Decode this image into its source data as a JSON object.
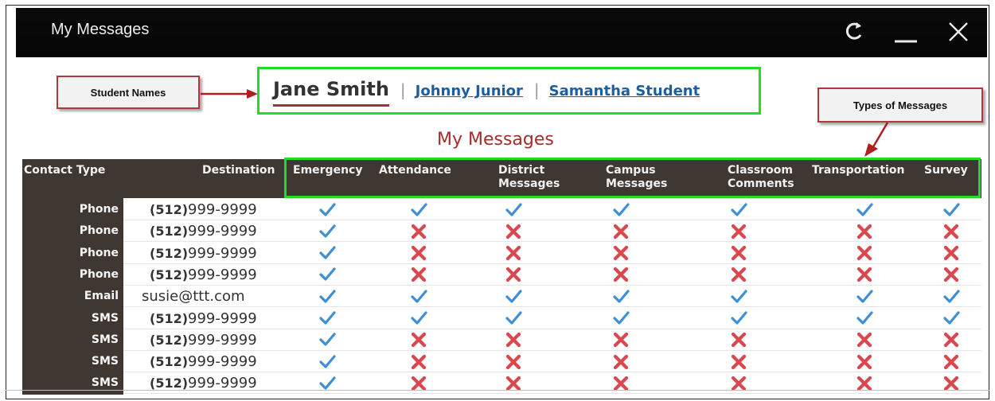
{
  "window": {
    "title": "My Messages",
    "refresh_icon": "refresh-icon",
    "minimize_icon": "minimize-icon",
    "close_icon": "close-icon"
  },
  "callouts": {
    "students": "Student Names",
    "types": "Types of Messages"
  },
  "students": {
    "active": "Jane Smith",
    "others": [
      "Johnny Junior",
      "Samantha Student"
    ],
    "separator": "|"
  },
  "heading": "My Messages",
  "table": {
    "headers": {
      "contact_type": "Contact Type",
      "destination": "Destination",
      "types": [
        [
          "Emergency"
        ],
        [
          "Attendance"
        ],
        [
          "District",
          "Messages"
        ],
        [
          "Campus",
          "Messages"
        ],
        [
          "Classroom",
          "Comments"
        ],
        [
          "Transportation"
        ],
        [
          "Survey"
        ]
      ]
    },
    "rows": [
      {
        "type": "Phone",
        "area": "(512)",
        "number": "999-9999",
        "flags": [
          true,
          true,
          true,
          true,
          true,
          true,
          true
        ]
      },
      {
        "type": "Phone",
        "area": "(512)",
        "number": "999-9999",
        "flags": [
          true,
          false,
          false,
          false,
          false,
          false,
          false
        ]
      },
      {
        "type": "Phone",
        "area": "(512)",
        "number": "999-9999",
        "flags": [
          true,
          false,
          false,
          false,
          false,
          false,
          false
        ]
      },
      {
        "type": "Phone",
        "area": "(512)",
        "number": "999-9999",
        "flags": [
          true,
          false,
          false,
          false,
          false,
          false,
          false
        ]
      },
      {
        "type": "Email",
        "area": "",
        "number": "susie@ttt.com",
        "flags": [
          true,
          true,
          true,
          true,
          true,
          true,
          true
        ]
      },
      {
        "type": "SMS",
        "area": "(512)",
        "number": "999-9999",
        "flags": [
          true,
          true,
          true,
          true,
          true,
          true,
          true
        ]
      },
      {
        "type": "SMS",
        "area": "(512)",
        "number": "999-9999",
        "flags": [
          true,
          false,
          false,
          false,
          false,
          false,
          false
        ]
      },
      {
        "type": "SMS",
        "area": "(512)",
        "number": "999-9999",
        "flags": [
          true,
          false,
          false,
          false,
          false,
          false,
          false
        ]
      },
      {
        "type": "SMS",
        "area": "(512)",
        "number": "999-9999",
        "flags": [
          true,
          false,
          false,
          false,
          false,
          false,
          false
        ]
      }
    ]
  },
  "colors": {
    "check": "#3d8fd6",
    "cross": "#d9484f",
    "highlight": "#22dd22",
    "callout_border": "#b03a3a",
    "header_bg": "#3f3731",
    "heading": "#a52c2c"
  }
}
